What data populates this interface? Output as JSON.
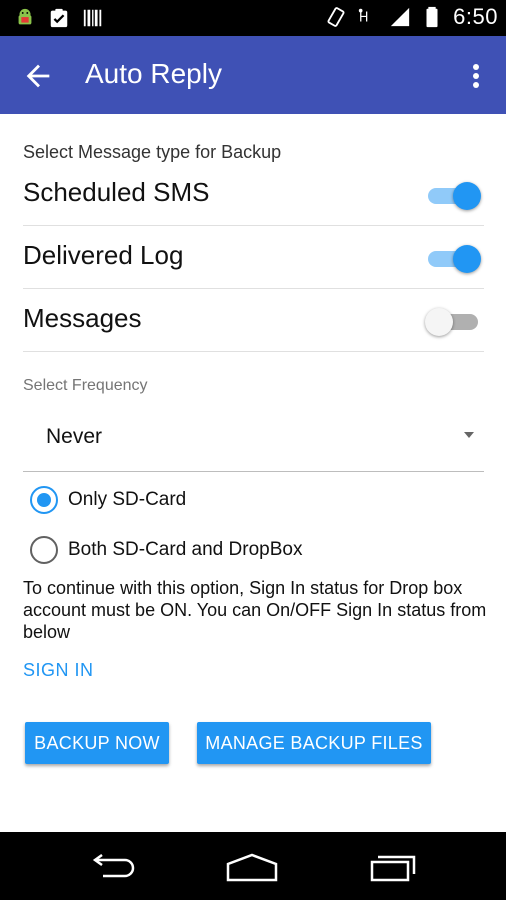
{
  "status_bar": {
    "time": "6:50",
    "left_icons": [
      "android-debug-icon",
      "clipboard-check-icon",
      "barcode-icon"
    ],
    "right_icons": [
      "rotate-phone-icon",
      "signal-h-icon",
      "signal-bars-icon",
      "battery-icon"
    ]
  },
  "app_bar": {
    "title": "Auto Reply",
    "back_icon": "arrow-left-icon",
    "menu_icon": "more-vert-icon",
    "color": "#3f51b5"
  },
  "backup_types": {
    "heading": "Select Message type for Backup",
    "items": [
      {
        "label": "Scheduled SMS",
        "enabled": true
      },
      {
        "label": "Delivered Log",
        "enabled": true
      },
      {
        "label": "Messages",
        "enabled": false
      }
    ]
  },
  "frequency": {
    "label": "Select Frequency",
    "selected": "Never"
  },
  "storage": {
    "options": [
      {
        "label": "Only SD-Card",
        "checked": true
      },
      {
        "label": "Both SD-Card and DropBox",
        "checked": false
      }
    ],
    "info": "To continue with this option, Sign In status for Drop box account must be ON. You can On/OFF Sign In status from below",
    "sign_in_label": "SIGN IN"
  },
  "actions": {
    "backup_now": "BACKUP NOW",
    "manage_files": "MANAGE BACKUP FILES"
  },
  "accent_color": "#2196f3",
  "nav_bar": {
    "icons": [
      "back-nav-icon",
      "home-nav-icon",
      "recents-nav-icon"
    ]
  }
}
